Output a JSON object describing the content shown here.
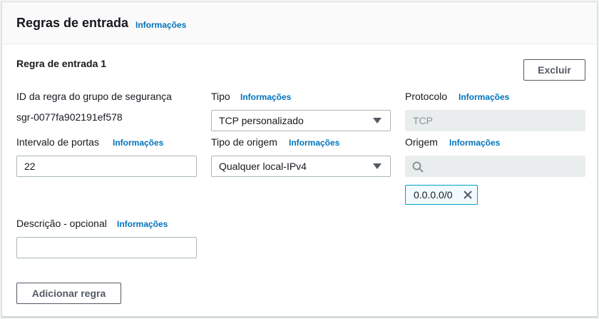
{
  "header": {
    "title": "Regras de entrada",
    "info": "Informações"
  },
  "rule": {
    "title": "Regra de entrada 1",
    "delete_label": "Excluir",
    "rule_id": {
      "label": "ID da regra do grupo de segurança",
      "value": "sgr-0077fa902191ef578"
    },
    "type": {
      "label": "Tipo",
      "info": "Informações",
      "value": "TCP personalizado"
    },
    "protocol": {
      "label": "Protocolo",
      "info": "Informações",
      "value": "TCP"
    },
    "port_range": {
      "label": "Intervalo de portas",
      "info": "Informações",
      "value": "22"
    },
    "source_type": {
      "label": "Tipo de origem",
      "info": "Informações",
      "value": "Qualquer local-IPv4"
    },
    "source": {
      "label": "Origem",
      "info": "Informações",
      "search_value": "",
      "token": "0.0.0.0/0"
    },
    "description": {
      "label": "Descrição - opcional",
      "info": "Informações",
      "value": ""
    }
  },
  "add_rule_label": "Adicionar regra",
  "colors": {
    "link": "#0073bb",
    "token_border": "#00a1c9",
    "token_bg": "#f1faff",
    "text": "#16191f"
  },
  "icons": {
    "search": "search-icon",
    "remove": "close-icon",
    "dropdown": "caret-down-icon"
  }
}
